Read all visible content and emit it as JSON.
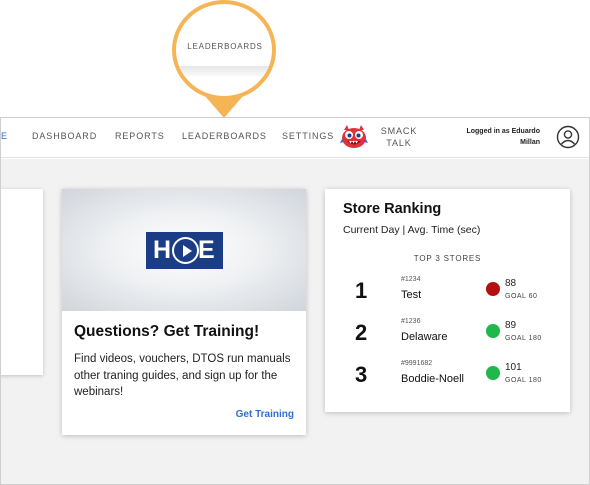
{
  "callout": {
    "label": "LEADERBOARDS"
  },
  "nav": {
    "partial_item": "E",
    "items": [
      "DASHBOARD",
      "REPORTS",
      "LEADERBOARDS",
      "SETTINGS"
    ],
    "smack_talk": [
      "SMACK",
      "TALK"
    ],
    "logged_in": [
      "Logged in as Eduardo",
      "Millan"
    ]
  },
  "training": {
    "logo": {
      "left": "H",
      "right": "E"
    },
    "title": "Questions? Get Training!",
    "description": "Find videos, vouchers, DTOS run manuals other traning guides, and sign up for the webinars!",
    "link": "Get Training"
  },
  "ranking": {
    "title": "Store Ranking",
    "subtitle": "Current Day | Avg. Time (sec)",
    "section_label": "TOP 3 STORES",
    "stores": [
      {
        "rank": "1",
        "id": "#1234",
        "name": "Test",
        "value": "88",
        "goal": "GOAL 60",
        "status_color": "#b30f0f"
      },
      {
        "rank": "2",
        "id": "#1236",
        "name": "Delaware",
        "value": "89",
        "goal": "GOAL 180",
        "status_color": "#1fb84b"
      },
      {
        "rank": "3",
        "id": "#9991682",
        "name": "Boddie-Noell",
        "value": "101",
        "goal": "GOAL 180",
        "status_color": "#1fb84b"
      }
    ]
  },
  "colors": {
    "accent": "#2d6fd0",
    "callout": "#f5b556",
    "brand_navy": "#1a3d86"
  },
  "icons": {
    "mascot": "smack-talk-monster-icon",
    "user": "user-profile-icon",
    "play": "play-icon"
  }
}
